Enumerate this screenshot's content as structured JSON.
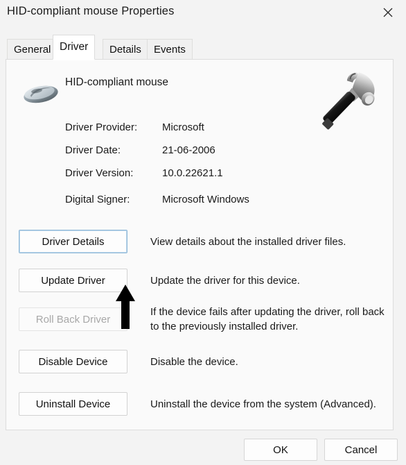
{
  "window": {
    "title": "HID-compliant mouse Properties",
    "close_icon": "close-icon"
  },
  "tabs": [
    {
      "label": "General",
      "selected": false
    },
    {
      "label": "Driver",
      "selected": true
    },
    {
      "label": "Details",
      "selected": false
    },
    {
      "label": "Events",
      "selected": false
    }
  ],
  "device": {
    "name": "HID-compliant mouse",
    "icon": "mouse-icon",
    "decoration_icon": "hammer-icon"
  },
  "info_rows": [
    {
      "label": "Driver Provider:",
      "value": "Microsoft"
    },
    {
      "label": "Driver Date:",
      "value": "21-06-2006"
    },
    {
      "label": "Driver Version:",
      "value": "10.0.22621.1"
    },
    {
      "label": "Digital Signer:",
      "value": "Microsoft Windows"
    }
  ],
  "actions": [
    {
      "label": "Driver Details",
      "description": "View details about the installed driver files.",
      "enabled": true,
      "focused": true
    },
    {
      "label": "Update Driver",
      "description": "Update the driver for this device.",
      "enabled": true,
      "focused": false
    },
    {
      "label": "Roll Back Driver",
      "description": "If the device fails after updating the driver, roll back to the previously installed driver.",
      "enabled": false,
      "focused": false
    },
    {
      "label": "Disable Device",
      "description": "Disable the device.",
      "enabled": true,
      "focused": false
    },
    {
      "label": "Uninstall Device",
      "description": "Uninstall the device from the system (Advanced).",
      "enabled": true,
      "focused": false
    }
  ],
  "footer": {
    "ok_label": "OK",
    "cancel_label": "Cancel"
  },
  "colors": {
    "window_bg": "#f3f3f3",
    "panel_bg": "#fafafa",
    "focus_border": "#8fb8d8",
    "disabled_text": "#a8a8a8",
    "cursor": "#000000"
  }
}
